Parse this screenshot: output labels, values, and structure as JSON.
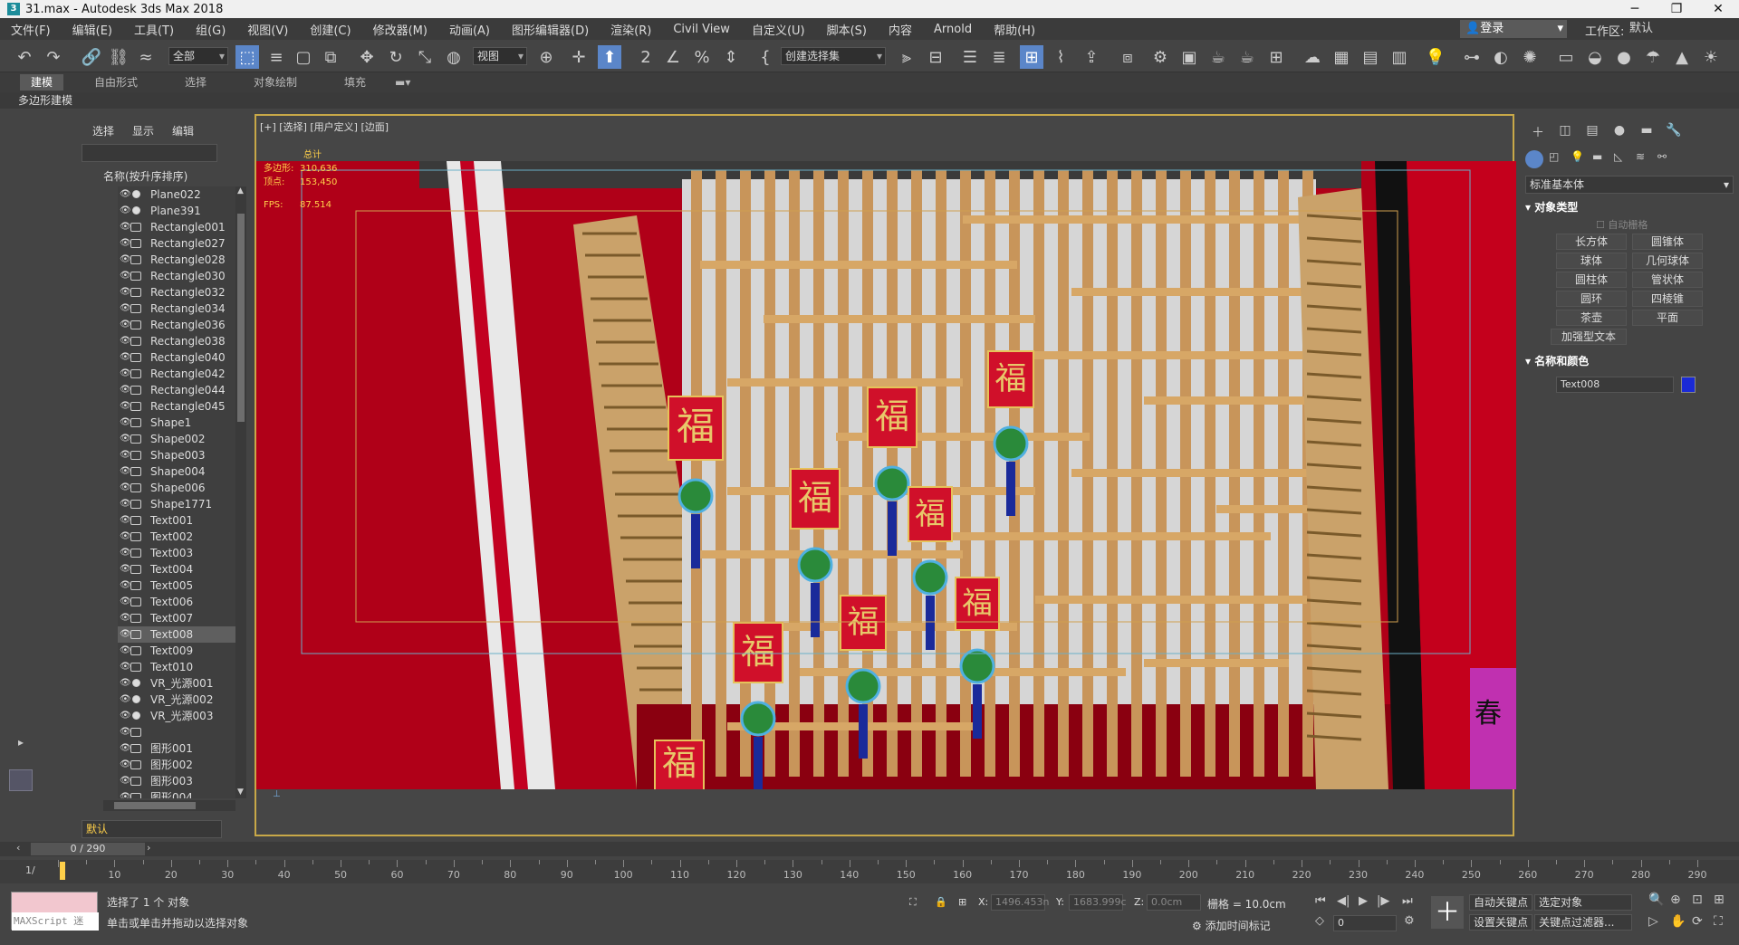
{
  "window": {
    "title": "31.max - Autodesk 3ds Max 2018",
    "icon_text": "3"
  },
  "menu": [
    "文件(F)",
    "编辑(E)",
    "工具(T)",
    "组(G)",
    "视图(V)",
    "创建(C)",
    "修改器(M)",
    "动画(A)",
    "图形编辑器(D)",
    "渲染(R)",
    "Civil View",
    "自定义(U)",
    "脚本(S)",
    "内容",
    "Arnold",
    "帮助(H)"
  ],
  "login": "登录",
  "workspace": {
    "label": "工作区:",
    "value": "默认"
  },
  "toolbar": {
    "filter": "全部",
    "ref_coord": "视图",
    "named_sel": "创建选择集"
  },
  "ribbon": {
    "tabs": [
      "建模",
      "自由形式",
      "选择",
      "对象绘制",
      "填充"
    ],
    "sub": "多边形建模"
  },
  "scene_explorer": {
    "tabs": [
      "选择",
      "显示",
      "编辑"
    ],
    "header": "名称(按升序排序)",
    "layer": "默认",
    "items": [
      {
        "name": "Plane022",
        "kind": "dot"
      },
      {
        "name": "Plane391",
        "kind": "dot"
      },
      {
        "name": "Rectangle001",
        "kind": "shape"
      },
      {
        "name": "Rectangle027",
        "kind": "shape"
      },
      {
        "name": "Rectangle028",
        "kind": "shape"
      },
      {
        "name": "Rectangle030",
        "kind": "shape"
      },
      {
        "name": "Rectangle032",
        "kind": "shape"
      },
      {
        "name": "Rectangle034",
        "kind": "shape"
      },
      {
        "name": "Rectangle036",
        "kind": "shape"
      },
      {
        "name": "Rectangle038",
        "kind": "shape"
      },
      {
        "name": "Rectangle040",
        "kind": "shape"
      },
      {
        "name": "Rectangle042",
        "kind": "shape"
      },
      {
        "name": "Rectangle044",
        "kind": "shape"
      },
      {
        "name": "Rectangle045",
        "kind": "shape"
      },
      {
        "name": "Shape1",
        "kind": "shape"
      },
      {
        "name": "Shape002",
        "kind": "shape"
      },
      {
        "name": "Shape003",
        "kind": "shape"
      },
      {
        "name": "Shape004",
        "kind": "shape"
      },
      {
        "name": "Shape006",
        "kind": "shape"
      },
      {
        "name": "Shape1771",
        "kind": "shape"
      },
      {
        "name": "Text001",
        "kind": "shape"
      },
      {
        "name": "Text002",
        "kind": "shape"
      },
      {
        "name": "Text003",
        "kind": "shape"
      },
      {
        "name": "Text004",
        "kind": "shape"
      },
      {
        "name": "Text005",
        "kind": "shape"
      },
      {
        "name": "Text006",
        "kind": "shape"
      },
      {
        "name": "Text007",
        "kind": "shape"
      },
      {
        "name": "Text008",
        "kind": "shape",
        "selected": true
      },
      {
        "name": "Text009",
        "kind": "shape"
      },
      {
        "name": "Text010",
        "kind": "shape"
      },
      {
        "name": "VR_光源001",
        "kind": "light"
      },
      {
        "name": "VR_光源002",
        "kind": "light"
      },
      {
        "name": "VR_光源003",
        "kind": "light"
      },
      {
        "name": "",
        "kind": "camera"
      },
      {
        "name": "图形001",
        "kind": "shape"
      },
      {
        "name": "图形002",
        "kind": "shape"
      },
      {
        "name": "图形003",
        "kind": "shape"
      },
      {
        "name": "图形004",
        "kind": "shape"
      }
    ]
  },
  "viewport": {
    "label": "[+] [选择] [用户定义] [边面]",
    "stats_title": "总计",
    "stats": [
      {
        "k": "多边形:",
        "v": "310,636"
      },
      {
        "k": "顶点:",
        "v": "153,450"
      },
      {
        "k": "FPS:",
        "v": "87.514"
      }
    ],
    "fu_char": "福",
    "chun_char": "春"
  },
  "command_panel": {
    "category": "标准基本体",
    "object_type_title": "对象类型",
    "auto_grid": "自动栅格",
    "buttons": [
      "长方体",
      "圆锥体",
      "球体",
      "几何球体",
      "圆柱体",
      "管状体",
      "圆环",
      "四棱锥",
      "茶壶",
      "平面",
      "加强型文本"
    ],
    "name_color_title": "名称和颜色",
    "object_name": "Text008",
    "object_color": "#1a2ad6"
  },
  "timeline": {
    "slider": "0 / 290",
    "ticks": [
      10,
      20,
      30,
      40,
      50,
      60,
      70,
      80,
      90,
      100,
      110,
      120,
      130,
      140,
      150,
      160,
      170,
      180,
      190,
      200,
      210,
      220,
      230,
      240,
      250,
      260,
      270,
      280,
      290
    ]
  },
  "status": {
    "maxscript": "MAXScript 迷",
    "selected": "选择了 1 个 对象",
    "prompt": "单击或单击并拖动以选择对象",
    "x_label": "X:",
    "x_value": "1496.453n",
    "y_label": "Y:",
    "y_value": "1683.999c",
    "z_label": "Z:",
    "z_value": "0.0cm",
    "grid": "栅格 = 10.0cm",
    "add_time_tag": "添加时间标记",
    "auto_key": "自动关键点",
    "selected_obj": "选定对象",
    "set_key": "设置关键点",
    "key_filters": "关键点过滤器...",
    "frame": "0"
  }
}
